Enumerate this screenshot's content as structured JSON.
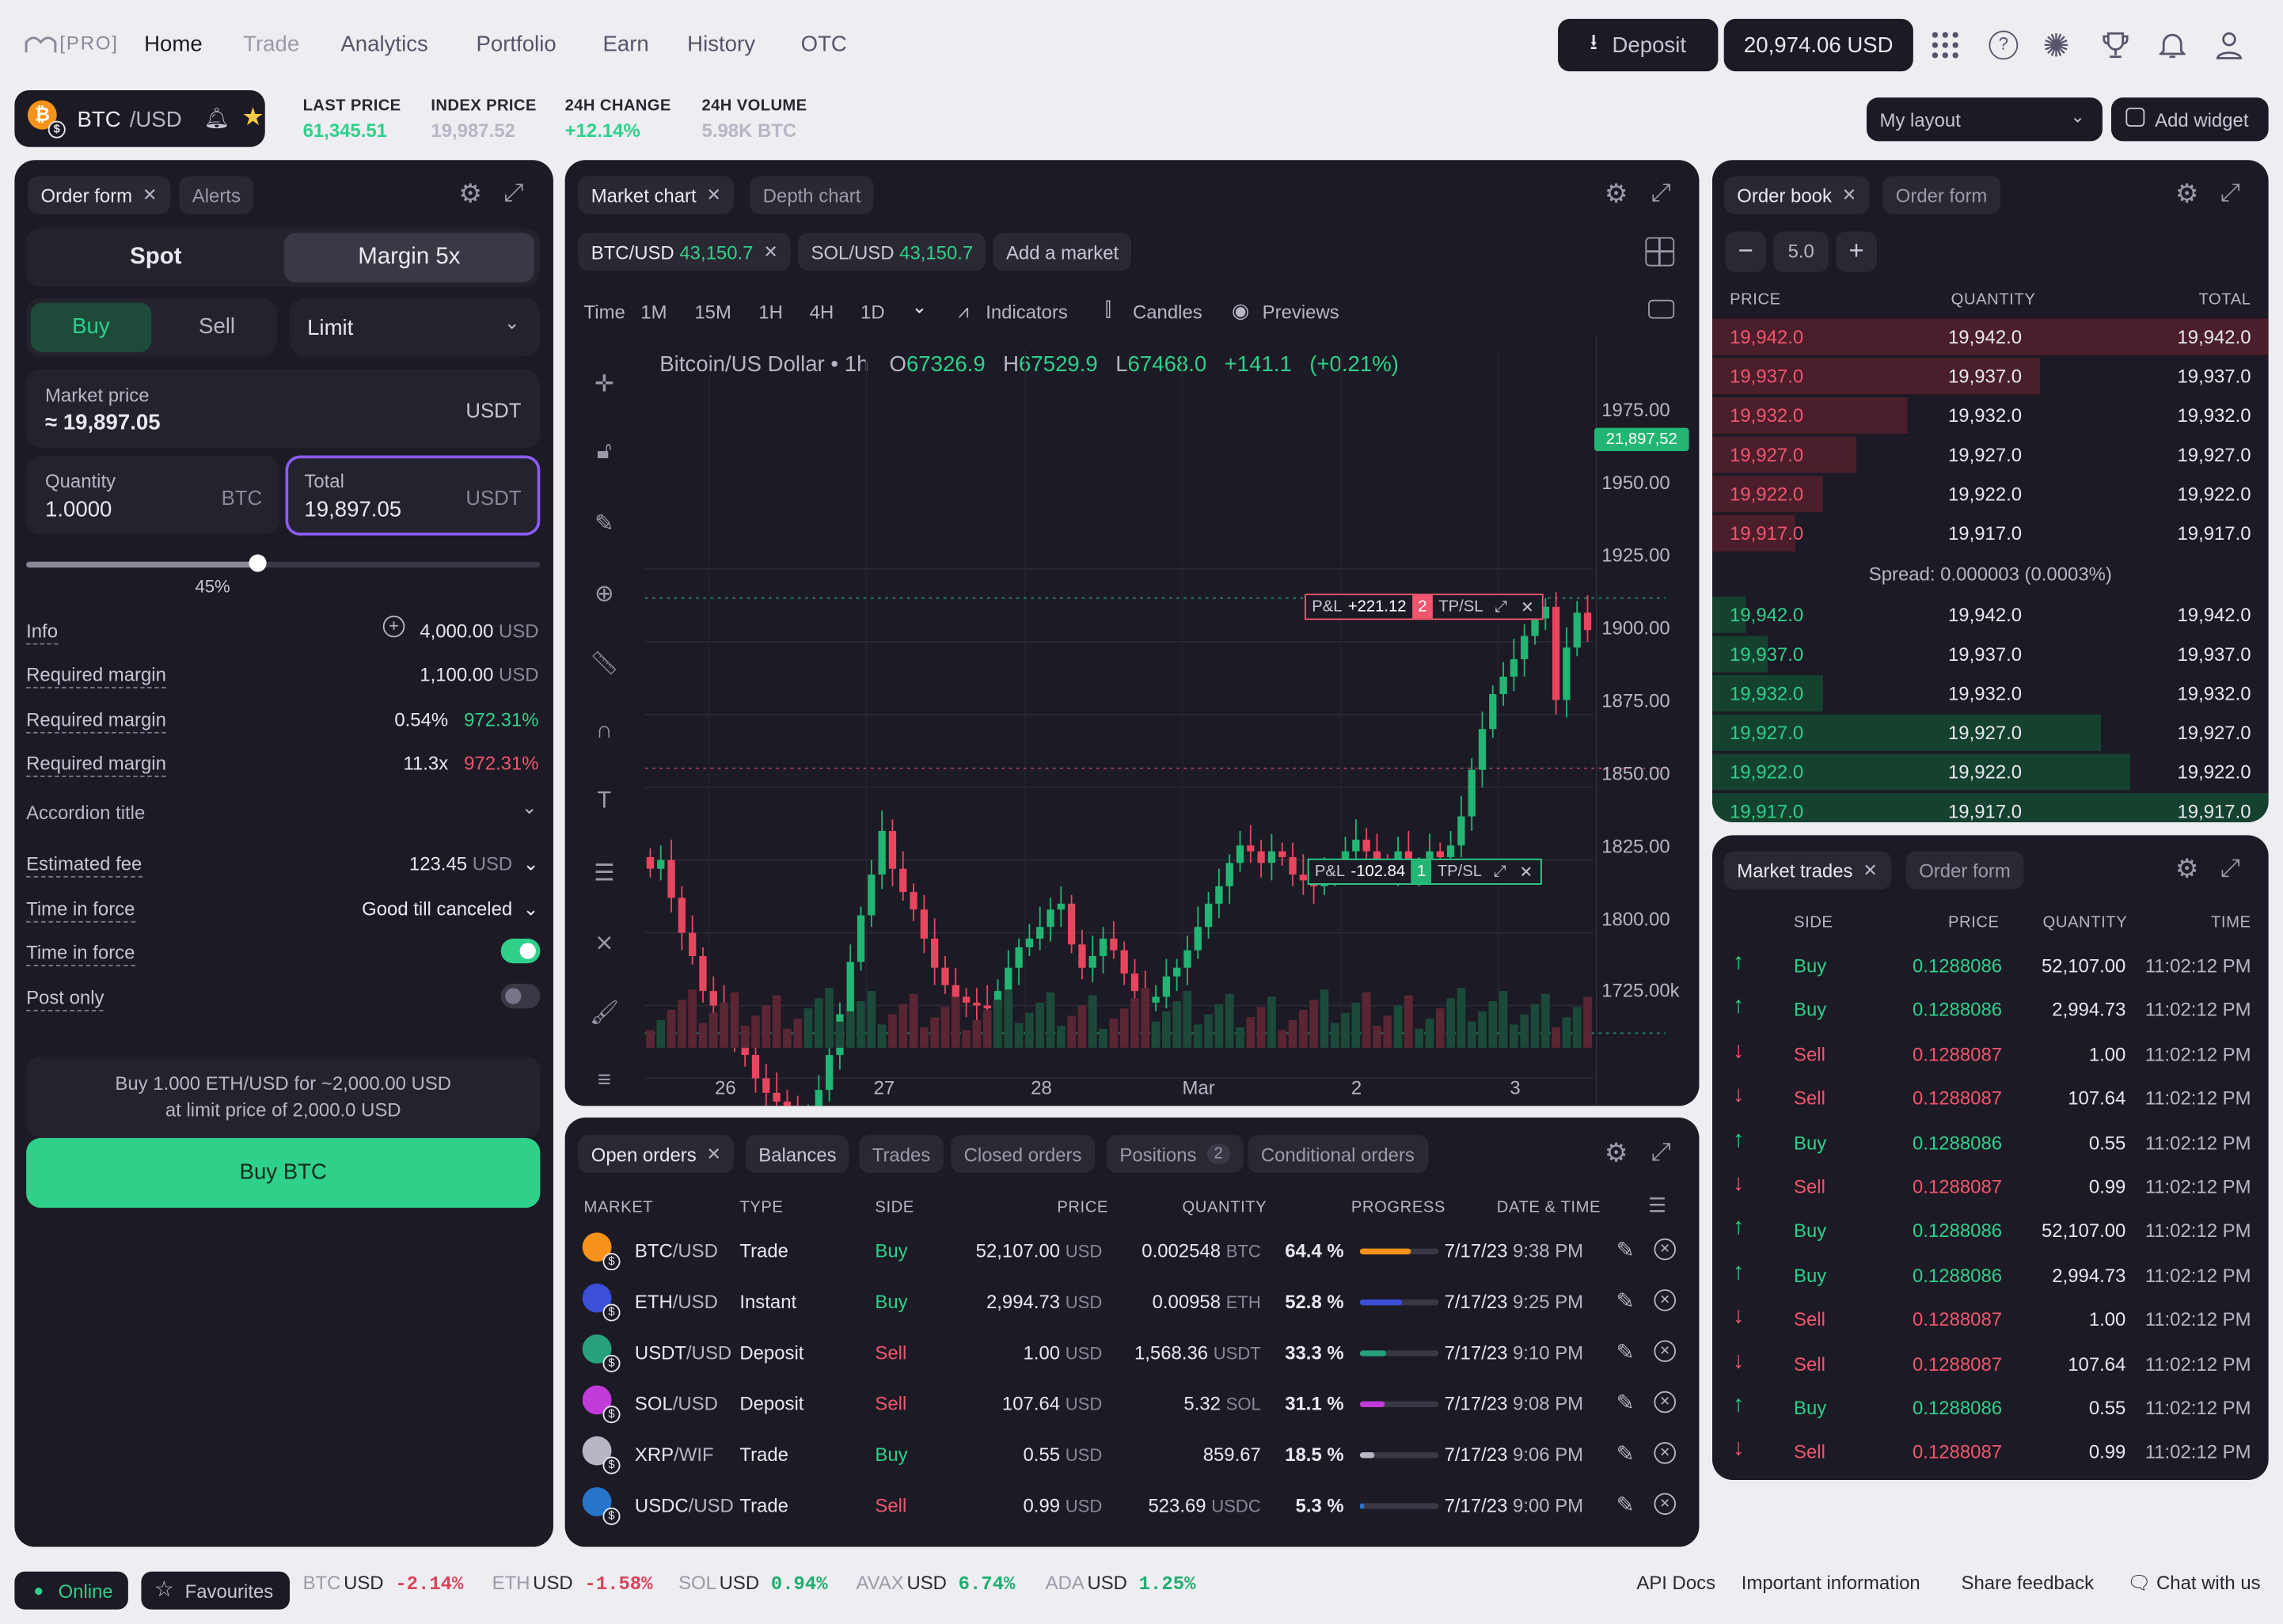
{
  "nav": {
    "logo": "PRO",
    "links": [
      "Home",
      "Trade",
      "Analytics",
      "Portfolio",
      "Earn",
      "History",
      "OTC"
    ],
    "deposit": "Deposit",
    "balance": "20,974.06 USD"
  },
  "ticker": {
    "pair_base": "BTC",
    "pair_quote": "/USD",
    "stats": [
      {
        "label": "LAST PRICE",
        "value": "61,345.51"
      },
      {
        "label": "INDEX PRICE",
        "value": "19,987.52"
      },
      {
        "label": "24H CHANGE",
        "value": "+12.14%"
      },
      {
        "label": "24H VOLUME",
        "value": "5.98K BTC"
      }
    ],
    "layout": "My layout",
    "add_widget": "Add widget"
  },
  "order_form": {
    "tabs": [
      "Order form",
      "Alerts"
    ],
    "mode": [
      "Spot",
      "Margin 5x"
    ],
    "side": [
      "Buy",
      "Sell"
    ],
    "order_type": "Limit",
    "market_price_label": "Market price",
    "market_price": "≈ 19,897.05",
    "market_price_unit": "USDT",
    "quantity_label": "Quantity",
    "quantity": "1.0000",
    "quantity_unit": "BTC",
    "total_label": "Total",
    "total": "19,897.05",
    "total_unit": "USDT",
    "slider_pct": "45%",
    "slider_value": 0.45,
    "info": [
      {
        "label": "Info",
        "value": "4,000.00",
        "unit": "USD"
      },
      {
        "label": "Required margin",
        "value": "1,100.00",
        "unit": "USD"
      },
      {
        "label": "Required margin",
        "value": "0.54%",
        "extra": "972.31%"
      },
      {
        "label": "Required margin",
        "value": "11.3x",
        "extra": "972.31%"
      }
    ],
    "accordion": "Accordion title",
    "fee_label": "Estimated fee",
    "fee_value": "123.45",
    "fee_unit": "USD",
    "tif_label": "Time in force",
    "tif_value": "Good till canceled",
    "tif2_label": "Time in force",
    "post_only_label": "Post only",
    "summary_line1": "Buy 1.000 ETH/USD for ~2,000.00 USD",
    "summary_line2": "at limit price of 2,000.0 USD",
    "buy_button": "Buy BTC"
  },
  "chart": {
    "tabs": [
      "Market chart",
      "Depth chart"
    ],
    "markets": [
      {
        "pair": "BTC/USD",
        "price": "43,150.7"
      },
      {
        "pair": "SOL/USD",
        "price": "43,150.7"
      }
    ],
    "add_market": "Add a market",
    "time_label": "Time",
    "intervals": [
      "1M",
      "15M",
      "1H",
      "4H",
      "1D"
    ],
    "indicators": "Indicators",
    "candles": "Candles",
    "previews": "Previews",
    "legend": {
      "name": "Bitcoin/US Dollar",
      "interval": "1h",
      "o": "67326.9",
      "h": "67529.9",
      "l": "67468.0",
      "chg": "+141.1",
      "pct": "(+0.21%)"
    },
    "price_tag": "21,897,52",
    "yticks": [
      "1975.00",
      "1950.00",
      "1925.00",
      "1900.00",
      "1875.00",
      "1850.00",
      "1825.00",
      "1800.00",
      "1725.00k"
    ],
    "xticks": [
      "26",
      "27",
      "28",
      "Mar",
      "2",
      "3"
    ],
    "pnl1": {
      "label": "P&L",
      "value": "+221.12",
      "count": "2",
      "tp": "TP/SL"
    },
    "pnl2": {
      "label": "P&L",
      "value": "-102.84",
      "count": "1",
      "tp": "TP/SL"
    }
  },
  "chart_data": {
    "type": "candlestick",
    "close": [
      1872,
      1875,
      1862,
      1850,
      1842,
      1830,
      1825,
      1818,
      1812,
      1808,
      1800,
      1795,
      1792,
      1788,
      1785,
      1788,
      1796,
      1808,
      1822,
      1840,
      1856,
      1870,
      1885,
      1872,
      1864,
      1858,
      1848,
      1838,
      1832,
      1828,
      1826,
      1825,
      1824,
      1830,
      1838,
      1845,
      1848,
      1852,
      1858,
      1860,
      1846,
      1838,
      1842,
      1848,
      1844,
      1836,
      1830,
      1826,
      1828,
      1835,
      1838,
      1844,
      1852,
      1860,
      1866,
      1874,
      1880,
      1878,
      1874,
      1878,
      1876,
      1870,
      1868,
      1866,
      1870,
      1872,
      1878,
      1882,
      1878,
      1874,
      1872,
      1878,
      1870,
      1872,
      1878,
      1876,
      1880,
      1890,
      1906,
      1920,
      1932,
      1938,
      1944,
      1952,
      1958,
      1962,
      1930,
      1948,
      1960,
      1954
    ],
    "ylim": [
      1725,
      1975
    ],
    "markers": [
      {
        "label": "P&L",
        "value": "+221.12"
      },
      {
        "label": "P&L",
        "value": "-102.84"
      }
    ]
  },
  "order_book": {
    "tabs": [
      "Order book",
      "Order form"
    ],
    "step": "5.0",
    "headers": [
      "PRICE",
      "QUANTITY",
      "TOTAL"
    ],
    "asks": [
      {
        "p": "19,942.0",
        "q": "19,942.0",
        "t": "19,942.0",
        "d": 1.0
      },
      {
        "p": "19,937.0",
        "q": "19,937.0",
        "t": "19,937.0",
        "d": 0.59
      },
      {
        "p": "19,932.0",
        "q": "19,932.0",
        "t": "19,932.0",
        "d": 0.35
      },
      {
        "p": "19,927.0",
        "q": "19,927.0",
        "t": "19,927.0",
        "d": 0.26
      },
      {
        "p": "19,922.0",
        "q": "19,922.0",
        "t": "19,922.0",
        "d": 0.2
      },
      {
        "p": "19,917.0",
        "q": "19,917.0",
        "t": "19,917.0",
        "d": 0.15
      }
    ],
    "spread": "Spread: 0.000003 (0.0003%)",
    "bids": [
      {
        "p": "19,942.0",
        "q": "19,942.0",
        "t": "19,942.0",
        "d": 0.06
      },
      {
        "p": "19,937.0",
        "q": "19,937.0",
        "t": "19,937.0",
        "d": 0.1
      },
      {
        "p": "19,932.0",
        "q": "19,932.0",
        "t": "19,932.0",
        "d": 0.2
      },
      {
        "p": "19,927.0",
        "q": "19,927.0",
        "t": "19,927.0",
        "d": 0.7
      },
      {
        "p": "19,922.0",
        "q": "19,922.0",
        "t": "19,922.0",
        "d": 0.75
      },
      {
        "p": "19,917.0",
        "q": "19,917.0",
        "t": "19,917.0",
        "d": 1.0
      }
    ]
  },
  "market_trades": {
    "tabs": [
      "Market trades",
      "Order form"
    ],
    "headers": [
      "SIDE",
      "PRICE",
      "QUANTITY",
      "TIME"
    ],
    "rows": [
      {
        "side": "Buy",
        "price": "0.1288086",
        "qty": "52,107.00",
        "time": "11:02:12 PM"
      },
      {
        "side": "Buy",
        "price": "0.1288086",
        "qty": "2,994.73",
        "time": "11:02:12 PM"
      },
      {
        "side": "Sell",
        "price": "0.1288087",
        "qty": "1.00",
        "time": "11:02:12 PM"
      },
      {
        "side": "Sell",
        "price": "0.1288087",
        "qty": "107.64",
        "time": "11:02:12 PM"
      },
      {
        "side": "Buy",
        "price": "0.1288086",
        "qty": "0.55",
        "time": "11:02:12 PM"
      },
      {
        "side": "Sell",
        "price": "0.1288087",
        "qty": "0.99",
        "time": "11:02:12 PM"
      },
      {
        "side": "Buy",
        "price": "0.1288086",
        "qty": "52,107.00",
        "time": "11:02:12 PM"
      },
      {
        "side": "Buy",
        "price": "0.1288086",
        "qty": "2,994.73",
        "time": "11:02:12 PM"
      },
      {
        "side": "Sell",
        "price": "0.1288087",
        "qty": "1.00",
        "time": "11:02:12 PM"
      },
      {
        "side": "Sell",
        "price": "0.1288087",
        "qty": "107.64",
        "time": "11:02:12 PM"
      },
      {
        "side": "Buy",
        "price": "0.1288086",
        "qty": "0.55",
        "time": "11:02:12 PM"
      },
      {
        "side": "Sell",
        "price": "0.1288087",
        "qty": "0.99",
        "time": "11:02:12 PM"
      }
    ]
  },
  "open_orders": {
    "tabs": [
      "Open orders",
      "Balances",
      "Trades",
      "Closed orders",
      "Positions",
      "Conditional orders"
    ],
    "positions_count": "2",
    "headers": [
      "MARKET",
      "TYPE",
      "SIDE",
      "PRICE",
      "QUANTITY",
      "PROGRESS",
      "DATE & TIME"
    ],
    "rows": [
      {
        "base": "BTC",
        "quote": "/USD",
        "type": "Trade",
        "side": "Buy",
        "price": "52,107.00",
        "pu": "USD",
        "qty": "0.002548",
        "qu": "BTC",
        "pct": "64.4",
        "prog": 0.644,
        "color": "#f7931a",
        "date": "7/17/23",
        "time": "9:38 PM"
      },
      {
        "base": "ETH",
        "quote": "/USD",
        "type": "Instant",
        "side": "Buy",
        "price": "2,994.73",
        "pu": "USD",
        "qty": "0.00958",
        "qu": "ETH",
        "pct": "52.8",
        "prog": 0.528,
        "color": "#3b4fd8",
        "date": "7/17/23",
        "time": "9:25 PM"
      },
      {
        "base": "USDT",
        "quote": "/USD",
        "type": "Deposit",
        "side": "Sell",
        "price": "1.00",
        "pu": "USD",
        "qty": "1,568.36",
        "qu": "USDT",
        "pct": "33.3",
        "prog": 0.333,
        "color": "#26a17b",
        "date": "7/17/23",
        "time": "9:10 PM"
      },
      {
        "base": "SOL",
        "quote": "/USD",
        "type": "Deposit",
        "side": "Sell",
        "price": "107.64",
        "pu": "USD",
        "qty": "5.32",
        "qu": "SOL",
        "pct": "31.1",
        "prog": 0.311,
        "color": "#c13bd8",
        "date": "7/17/23",
        "time": "9:08 PM"
      },
      {
        "base": "XRP",
        "quote": "/WIF",
        "type": "Trade",
        "side": "Buy",
        "price": "0.55",
        "pu": "USD",
        "qty": "859.67",
        "qu": "",
        "pct": "18.5",
        "prog": 0.185,
        "color": "#b8b6c4",
        "date": "7/17/23",
        "time": "9:06 PM"
      },
      {
        "base": "USDC",
        "quote": "/USD",
        "type": "Trade",
        "side": "Sell",
        "price": "0.99",
        "pu": "USD",
        "qty": "523.69",
        "qu": "USDC",
        "pct": "5.3",
        "prog": 0.053,
        "color": "#2775ca",
        "date": "7/17/23",
        "time": "9:00 PM"
      }
    ]
  },
  "footer": {
    "online": "Online",
    "favourites": "Favourites",
    "tickers": [
      {
        "sym": "BTC",
        "q": "USD",
        "chg": "-2.14%"
      },
      {
        "sym": "ETH",
        "q": "USD",
        "chg": "-1.58%"
      },
      {
        "sym": "SOL",
        "q": "USD",
        "chg": "0.94%"
      },
      {
        "sym": "AVAX",
        "q": "USD",
        "chg": "6.74%"
      },
      {
        "sym": "ADA",
        "q": "USD",
        "chg": "1.25%"
      }
    ],
    "links": [
      "API Docs",
      "Important information",
      "Share feedback",
      "Chat with us"
    ]
  }
}
